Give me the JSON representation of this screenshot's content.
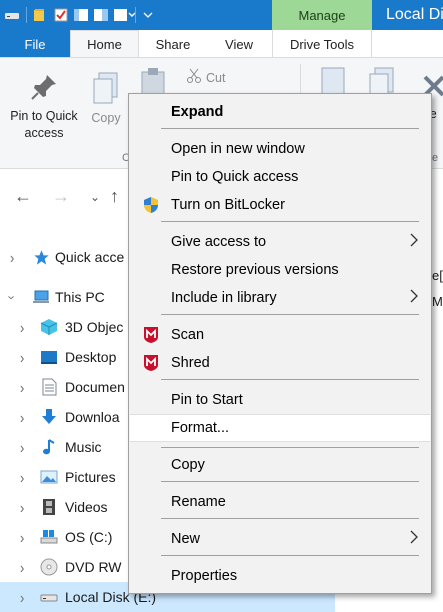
{
  "titlebar": {
    "manage_label": "Manage",
    "window_title": "Local Di",
    "accent_color": "#1979ca",
    "manage_color": "#9ed896"
  },
  "ribbon_tabs": {
    "file": "File",
    "home": "Home",
    "share": "Share",
    "view": "View",
    "drive_tools": "Drive Tools"
  },
  "ribbon": {
    "pin_quick_access_line1": "Pin to Quick",
    "pin_quick_access_line2": "access",
    "copy": "Copy",
    "cut": "Cut",
    "clipboard_frag": "C",
    "delete_frag": "ele",
    "organize_frag": "e"
  },
  "tree": {
    "items": [
      {
        "label": "Quick acce",
        "icon": "star-icon"
      },
      {
        "label": "This PC",
        "icon": "computer-icon"
      },
      {
        "label": "3D Objec",
        "icon": "cube-icon"
      },
      {
        "label": "Desktop",
        "icon": "desktop-icon"
      },
      {
        "label": "Documen",
        "icon": "document-icon"
      },
      {
        "label": "Downloa",
        "icon": "download-icon"
      },
      {
        "label": "Music",
        "icon": "music-icon"
      },
      {
        "label": "Pictures",
        "icon": "pictures-icon"
      },
      {
        "label": "Videos",
        "icon": "film-icon"
      },
      {
        "label": "OS (C:)",
        "icon": "os-drive-icon"
      },
      {
        "label": "DVD RW",
        "icon": "dvd-icon"
      },
      {
        "label": "Local Disk (E:)",
        "icon": "drive-icon"
      }
    ]
  },
  "right_pane": {
    "frag1": "e[",
    "frag2": "M"
  },
  "context_menu": {
    "expand": "Expand",
    "open_new_window": "Open in new window",
    "pin_quick_access": "Pin to Quick access",
    "turn_on_bitlocker": "Turn on BitLocker",
    "give_access_to": "Give access to",
    "restore_previous_versions": "Restore previous versions",
    "include_in_library": "Include in library",
    "scan": "Scan",
    "shred": "Shred",
    "pin_to_start": "Pin to Start",
    "format": "Format...",
    "copy": "Copy",
    "rename": "Rename",
    "new": "New",
    "properties": "Properties",
    "mcafee_color": "#c8102e"
  }
}
